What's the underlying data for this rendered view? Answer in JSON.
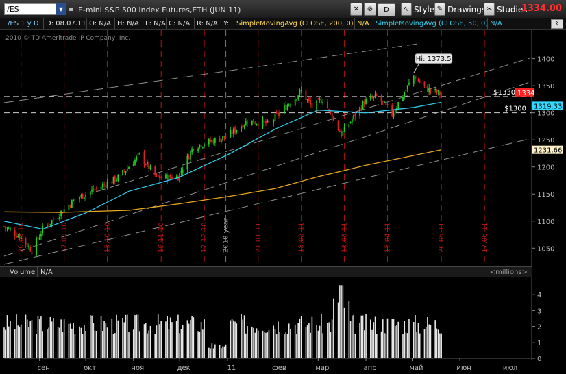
{
  "toolbar": {
    "symbol": "/ES",
    "instrument_title": "E-mini S&P 500 Index Futures,ETH (JUN 11)",
    "drawing_set": "D",
    "style_label": "Style",
    "drawings_label": "Drawings",
    "studies_label": "Studies",
    "last_price": "1334.00"
  },
  "info_row": {
    "aggregation": "/ES 1 y D",
    "date": "D: 08.07.11",
    "open": "O: N/A",
    "high": "H: N/A",
    "low": "L: N/A",
    "close": "C: N/A",
    "range": "R: N/A",
    "y": "Y:",
    "sma200_label": "SimpleMovingAvg (CLOSE, 200, 0)",
    "sma200_value": "N/A",
    "sma50_label": "SimpleMovingAvg (CLOSE, 50, 0)",
    "sma50_value": "N/A"
  },
  "copyright": "2010 © TD Ameritrade IP Company, Inc.",
  "volume_panel": {
    "label": "Volume",
    "value": "N/A",
    "units": "<millions>"
  },
  "colors": {
    "up_candle": "#22cc22",
    "down_candle": "#dd2222",
    "sma50": "#33c8e8",
    "sma200": "#e8a820",
    "guide_line": "#b01414",
    "last_price_tag": "#ff2020",
    "sma50_tag": "#33d8ff",
    "sma200_tag": "#fff1c8"
  },
  "chart_data": [
    {
      "type": "candlestick",
      "title": "E-mini S&P 500 Index Futures,ETH (JUN 11)",
      "ylim": [
        1020,
        1440
      ],
      "yticks": [
        1050,
        1100,
        1150,
        1200,
        1250,
        1300,
        1350,
        1400
      ],
      "date_markers": [
        "20.08.10",
        "17.09.10",
        "15.10.10",
        "19.11.10",
        "17.12.10",
        "2010 year",
        "21.01.11",
        "18.02.11",
        "18.03.11",
        "15.04.11",
        "20.05.11",
        "17.06.11"
      ],
      "price_path": [
        {
          "date": "2010-08-09",
          "price": 1090
        },
        {
          "date": "2010-08-20",
          "price": 1070
        },
        {
          "date": "2010-08-27",
          "price": 1045
        },
        {
          "date": "2010-09-03",
          "price": 1085
        },
        {
          "date": "2010-09-24",
          "price": 1140
        },
        {
          "date": "2010-10-08",
          "price": 1160
        },
        {
          "date": "2010-10-22",
          "price": 1180
        },
        {
          "date": "2010-11-05",
          "price": 1222
        },
        {
          "date": "2010-11-16",
          "price": 1180
        },
        {
          "date": "2010-11-30",
          "price": 1182
        },
        {
          "date": "2010-12-10",
          "price": 1238
        },
        {
          "date": "2010-12-31",
          "price": 1255
        },
        {
          "date": "2011-01-14",
          "price": 1285
        },
        {
          "date": "2011-01-28",
          "price": 1280
        },
        {
          "date": "2011-02-18",
          "price": 1340
        },
        {
          "date": "2011-02-25",
          "price": 1310
        },
        {
          "date": "2011-03-04",
          "price": 1325
        },
        {
          "date": "2011-03-16",
          "price": 1260
        },
        {
          "date": "2011-03-31",
          "price": 1320
        },
        {
          "date": "2011-04-08",
          "price": 1330
        },
        {
          "date": "2011-04-18",
          "price": 1298
        },
        {
          "date": "2011-05-02",
          "price": 1368
        },
        {
          "date": "2011-05-10",
          "price": 1345
        },
        {
          "date": "2011-05-20",
          "price": 1334
        }
      ],
      "high_annotation": "Hi: 1373.5",
      "horizontal_lines": [
        {
          "label": "$1330.12",
          "value": 1330.12
        },
        {
          "label": "$1300",
          "value": 1300
        }
      ],
      "series": [
        {
          "name": "SimpleMovingAvg (CLOSE, 50, 0)",
          "last": "1319.33",
          "values": [
            {
              "date": "2010-08-09",
              "value": 1100
            },
            {
              "date": "2010-09-03",
              "value": 1085
            },
            {
              "date": "2010-10-01",
              "value": 1115
            },
            {
              "date": "2010-10-29",
              "value": 1155
            },
            {
              "date": "2010-11-30",
              "value": 1180
            },
            {
              "date": "2011-01-03",
              "value": 1225
            },
            {
              "date": "2011-02-01",
              "value": 1270
            },
            {
              "date": "2011-03-01",
              "value": 1305
            },
            {
              "date": "2011-04-01",
              "value": 1300
            },
            {
              "date": "2011-05-02",
              "value": 1310
            },
            {
              "date": "2011-05-20",
              "value": 1319.33
            }
          ]
        },
        {
          "name": "SimpleMovingAvg (CLOSE, 200, 0)",
          "last": "1231.66",
          "values": [
            {
              "date": "2010-08-09",
              "value": 1117
            },
            {
              "date": "2010-09-15",
              "value": 1116
            },
            {
              "date": "2010-10-29",
              "value": 1120
            },
            {
              "date": "2010-12-01",
              "value": 1132
            },
            {
              "date": "2011-01-03",
              "value": 1146
            },
            {
              "date": "2011-02-01",
              "value": 1160
            },
            {
              "date": "2011-03-01",
              "value": 1182
            },
            {
              "date": "2011-04-01",
              "value": 1203
            },
            {
              "date": "2011-05-20",
              "value": 1231.66
            }
          ]
        }
      ],
      "price_tags": [
        {
          "label": "1334",
          "value": 1334,
          "color": "last_price_tag"
        },
        {
          "label": "1319.33",
          "value": 1319.33,
          "color": "sma50_tag"
        },
        {
          "label": "1231.66",
          "value": 1231.66,
          "color": "sma200_tag"
        }
      ]
    },
    {
      "type": "bar",
      "title": "Volume",
      "ylabel": "<millions>",
      "ylim": [
        0,
        5
      ],
      "yticks": [
        0,
        1,
        2,
        3,
        4
      ],
      "peak": {
        "date": "2011-03-16",
        "value": 4.6
      }
    }
  ],
  "x_axis_months": [
    "сен",
    "окт",
    "ноя",
    "дек",
    "11",
    "фев",
    "мар",
    "апр",
    "май",
    "июн",
    "июл"
  ]
}
